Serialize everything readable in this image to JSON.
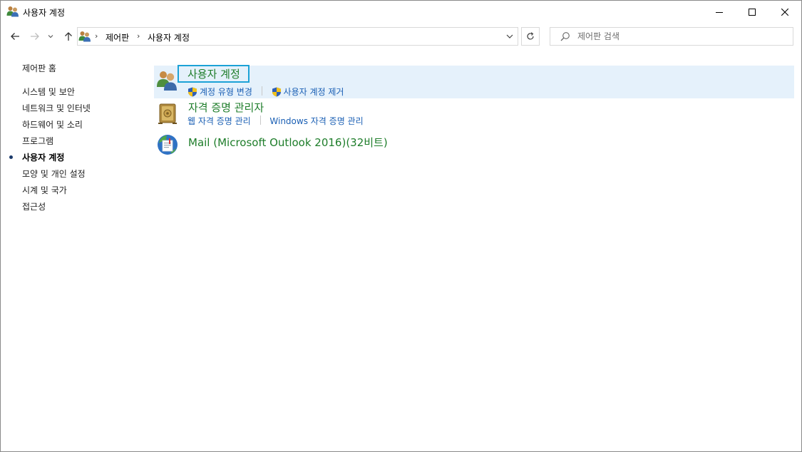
{
  "window": {
    "title": "사용자 계정",
    "controls": [
      "minimize",
      "maximize",
      "close"
    ]
  },
  "navigation": {
    "breadcrumb": [
      "제어판",
      "사용자 계정"
    ],
    "search_placeholder": "제어판 검색"
  },
  "left_pane": {
    "home_link": "제어판 홈",
    "items": [
      {
        "label": "시스템 및 보안",
        "current": false
      },
      {
        "label": "네트워크 및 인터넷",
        "current": false
      },
      {
        "label": "하드웨어 및 소리",
        "current": false
      },
      {
        "label": "프로그램",
        "current": false
      },
      {
        "label": "사용자 계정",
        "current": true
      },
      {
        "label": "모양 및 개인 설정",
        "current": false
      },
      {
        "label": "시계 및 국가",
        "current": false
      },
      {
        "label": "접근성",
        "current": false
      }
    ]
  },
  "categories": [
    {
      "title": "사용자 계정",
      "icon": "users-icon",
      "tasks": [
        {
          "label": "계정 유형 변경",
          "icon": "shield-icon"
        },
        {
          "label": "사용자 계정 제거",
          "icon": "shield-icon"
        }
      ]
    },
    {
      "title": "자격 증명 관리자",
      "icon": "vault-icon",
      "tasks": [
        {
          "label": "웹 자격 증명 관리"
        },
        {
          "label": "Windows 자격 증명 관리"
        }
      ]
    },
    {
      "title": "Mail (Microsoft Outlook 2016)(32비트)",
      "icon": "mail-icon",
      "tasks": []
    }
  ],
  "colors": {
    "category_title": "#1e7d2a",
    "task_link": "#1a5fb4",
    "hover_background": "#e5f1fb",
    "focus_outline": "#1ca2d6"
  }
}
